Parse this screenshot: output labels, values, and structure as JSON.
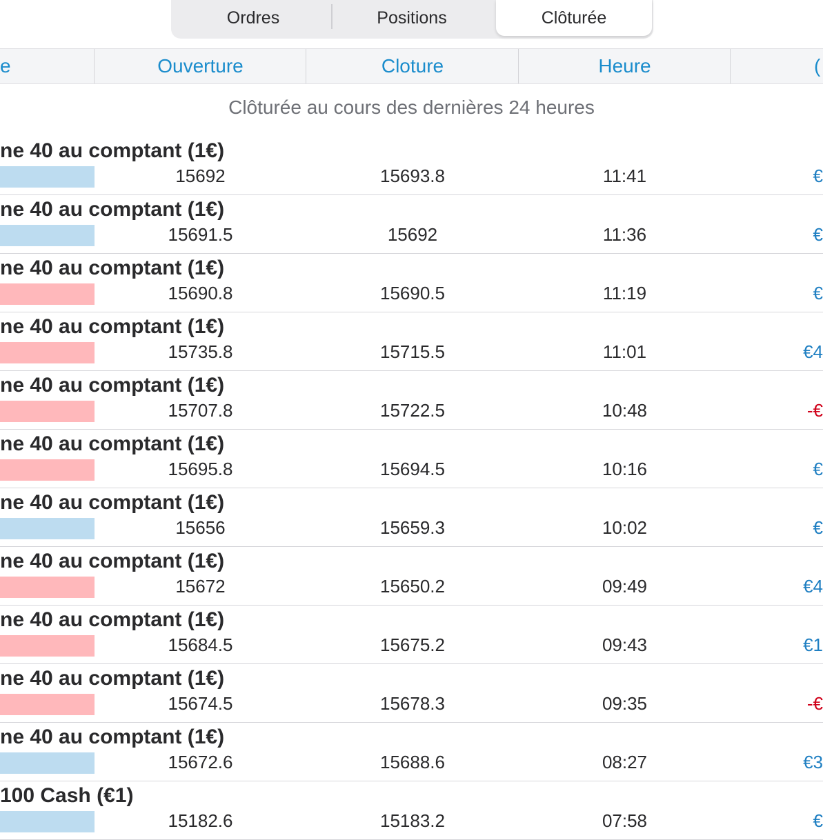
{
  "colors": {
    "accent": "#1a8ccc",
    "buy": "#bddcf0",
    "sell": "#ffb8bb",
    "profit": "#1f7fc2",
    "loss": "#d0021b"
  },
  "tabs": [
    {
      "label": "Ordres"
    },
    {
      "label": "Positions"
    },
    {
      "label": "Clôturée",
      "selected": true
    }
  ],
  "columns": {
    "name": "e",
    "open": "Ouverture",
    "close": "Cloture",
    "time": "Heure",
    "pnl": "("
  },
  "subtitle": "Clôturée au cours des dernières 24 heures",
  "rows": [
    {
      "instrument": "ne 40 au comptant (1€)",
      "side": "buy",
      "open": "15692",
      "close": "15693.8",
      "time": "11:41",
      "pnl": "€",
      "pnl_sign": "profit"
    },
    {
      "instrument": "ne 40 au comptant (1€)",
      "side": "buy",
      "open": "15691.5",
      "close": "15692",
      "time": "11:36",
      "pnl": "€",
      "pnl_sign": "profit"
    },
    {
      "instrument": "ne 40 au comptant (1€)",
      "side": "sell",
      "open": "15690.8",
      "close": "15690.5",
      "time": "11:19",
      "pnl": "€",
      "pnl_sign": "profit"
    },
    {
      "instrument": "ne 40 au comptant (1€)",
      "side": "sell",
      "open": "15735.8",
      "close": "15715.5",
      "time": "11:01",
      "pnl": "€4",
      "pnl_sign": "profit"
    },
    {
      "instrument": "ne 40 au comptant (1€)",
      "side": "sell",
      "open": "15707.8",
      "close": "15722.5",
      "time": "10:48",
      "pnl": "-€",
      "pnl_sign": "loss"
    },
    {
      "instrument": "ne 40 au comptant (1€)",
      "side": "sell",
      "open": "15695.8",
      "close": "15694.5",
      "time": "10:16",
      "pnl": "€",
      "pnl_sign": "profit"
    },
    {
      "instrument": "ne 40 au comptant (1€)",
      "side": "buy",
      "open": "15656",
      "close": "15659.3",
      "time": "10:02",
      "pnl": "€",
      "pnl_sign": "profit"
    },
    {
      "instrument": "ne 40 au comptant (1€)",
      "side": "sell",
      "open": "15672",
      "close": "15650.2",
      "time": "09:49",
      "pnl": "€4",
      "pnl_sign": "profit"
    },
    {
      "instrument": "ne 40 au comptant (1€)",
      "side": "sell",
      "open": "15684.5",
      "close": "15675.2",
      "time": "09:43",
      "pnl": "€1",
      "pnl_sign": "profit"
    },
    {
      "instrument": "ne 40 au comptant (1€)",
      "side": "sell",
      "open": "15674.5",
      "close": "15678.3",
      "time": "09:35",
      "pnl": "-€",
      "pnl_sign": "loss"
    },
    {
      "instrument": "ne 40 au comptant (1€)",
      "side": "buy",
      "open": "15672.6",
      "close": "15688.6",
      "time": "08:27",
      "pnl": "€3",
      "pnl_sign": "profit"
    },
    {
      "instrument": " 100 Cash (€1)",
      "side": "buy",
      "open": "15182.6",
      "close": "15183.2",
      "time": "07:58",
      "pnl": "€",
      "pnl_sign": "profit"
    }
  ]
}
